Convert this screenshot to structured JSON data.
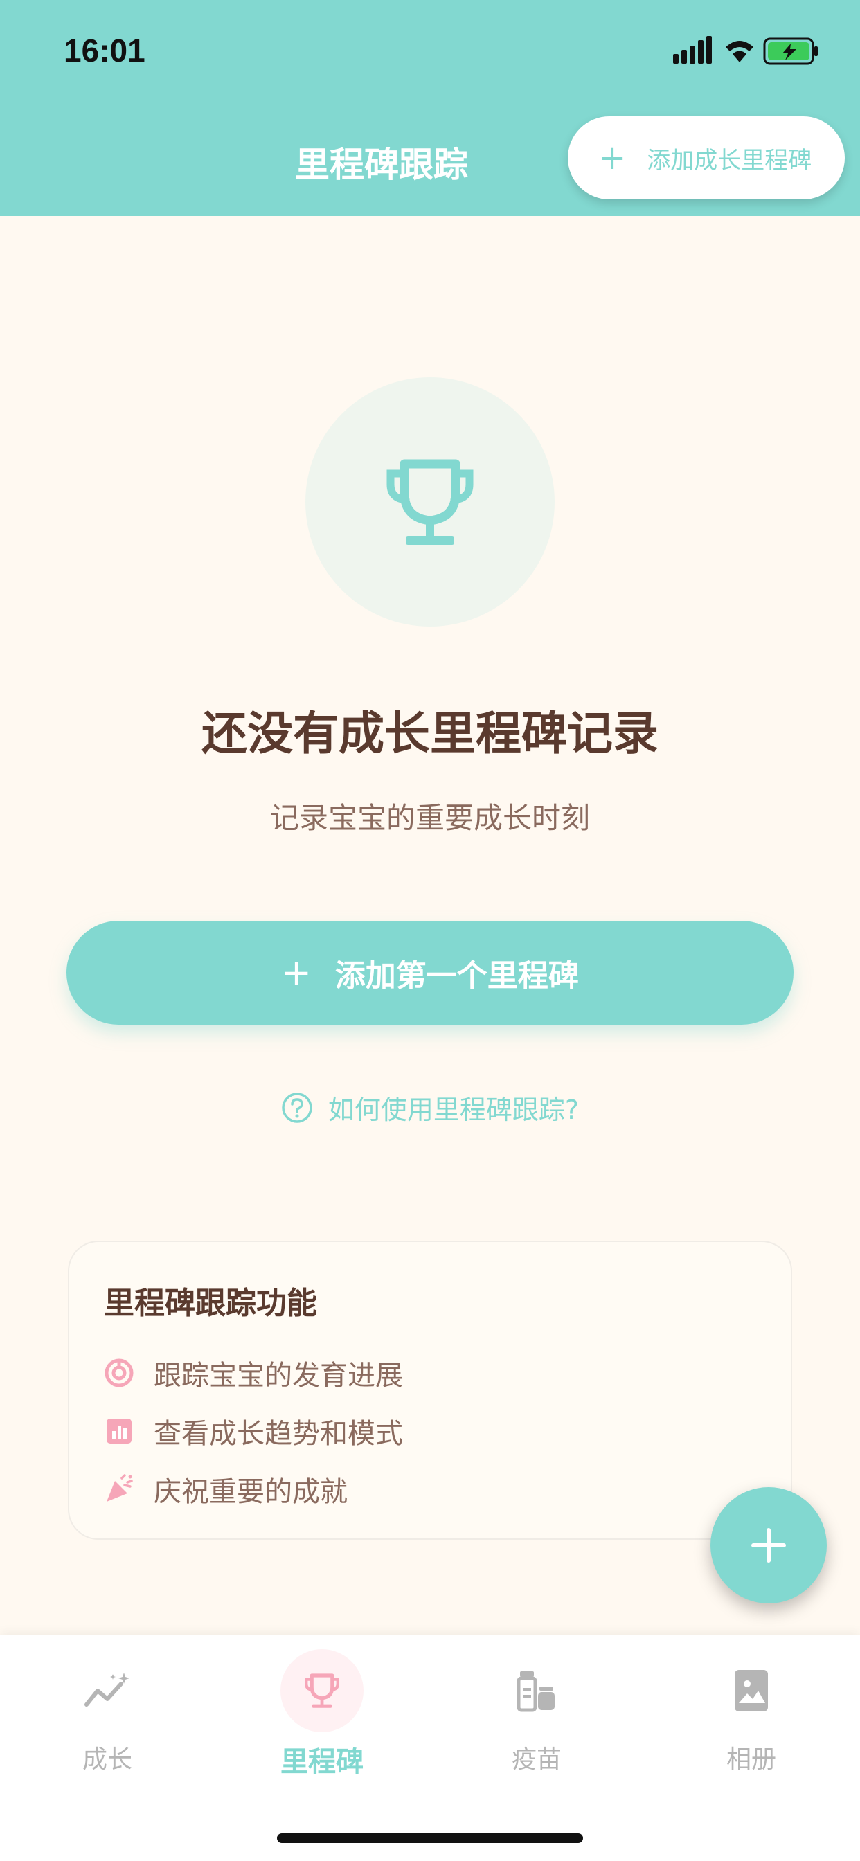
{
  "status": {
    "time": "16:01"
  },
  "header": {
    "title": "里程碑跟踪",
    "add_button_label": "添加成长里程碑"
  },
  "empty_state": {
    "icon": "trophy-icon",
    "title": "还没有成长里程碑记录",
    "subtitle": "记录宝宝的重要成长时刻",
    "primary_button_label": "添加第一个里程碑",
    "help_link_label": "如何使用里程碑跟踪?"
  },
  "feature_card": {
    "title": "里程碑跟踪功能",
    "items": [
      {
        "icon": "target-icon",
        "text": "跟踪宝宝的发育进展"
      },
      {
        "icon": "bar-chart-icon",
        "text": "查看成长趋势和模式"
      },
      {
        "icon": "party-popper-icon",
        "text": "庆祝重要的成就"
      }
    ]
  },
  "bottom_nav": {
    "items": [
      {
        "icon": "growth-chart-icon",
        "label": "成长",
        "active": false
      },
      {
        "icon": "trophy-icon",
        "label": "里程碑",
        "active": true
      },
      {
        "icon": "vaccine-icon",
        "label": "疫苗",
        "active": false
      },
      {
        "icon": "photo-album-icon",
        "label": "相册",
        "active": false
      }
    ]
  },
  "colors": {
    "accent": "#82D8D0",
    "background": "#FFF9F1",
    "title_text": "#5A3A2E",
    "body_text": "#8A6A5E",
    "pink": "#F6A6B8",
    "inactive": "#B5B5B5"
  }
}
